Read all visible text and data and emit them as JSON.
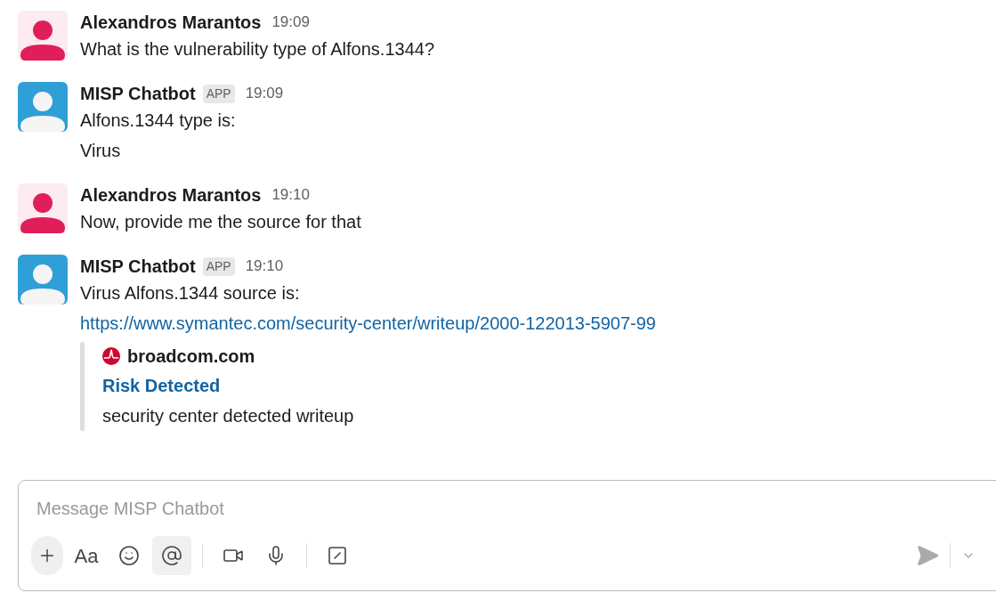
{
  "messages": [
    {
      "kind": "user",
      "author": "Alexandros Marantos",
      "time": "19:09",
      "lines": [
        {
          "kind": "text",
          "text": "What is the vulnerability type of Alfons.1344?"
        }
      ]
    },
    {
      "kind": "bot",
      "author": "MISP Chatbot",
      "badge": "APP",
      "time": "19:09",
      "lines": [
        {
          "kind": "text",
          "text": "Alfons.1344 type is:"
        },
        {
          "kind": "text",
          "text": "Virus"
        }
      ]
    },
    {
      "kind": "user",
      "author": "Alexandros Marantos",
      "time": "19:10",
      "lines": [
        {
          "kind": "text",
          "text": "Now, provide me the source for that"
        }
      ]
    },
    {
      "kind": "bot",
      "author": "MISP Chatbot",
      "badge": "APP",
      "time": "19:10",
      "lines": [
        {
          "kind": "text",
          "text": "Virus Alfons.1344 source is:"
        },
        {
          "kind": "link",
          "text": "https://www.symantec.com/security-center/writeup/2000-122013-5907-99"
        }
      ],
      "unfurl": {
        "site": "broadcom.com",
        "title": "Risk Detected",
        "description": "security center detected writeup"
      }
    }
  ],
  "composer": {
    "placeholder": "Message MISP Chatbot",
    "tools": [
      {
        "kind": "plus",
        "selected": false
      },
      {
        "kind": "format",
        "label": "Aa",
        "selected": false
      },
      {
        "kind": "emoji",
        "selected": false
      },
      {
        "kind": "mention",
        "selected": true
      },
      {
        "kind": "divider"
      },
      {
        "kind": "video",
        "selected": false
      },
      {
        "kind": "mic",
        "selected": false
      },
      {
        "kind": "divider"
      },
      {
        "kind": "slash",
        "selected": false
      }
    ]
  }
}
